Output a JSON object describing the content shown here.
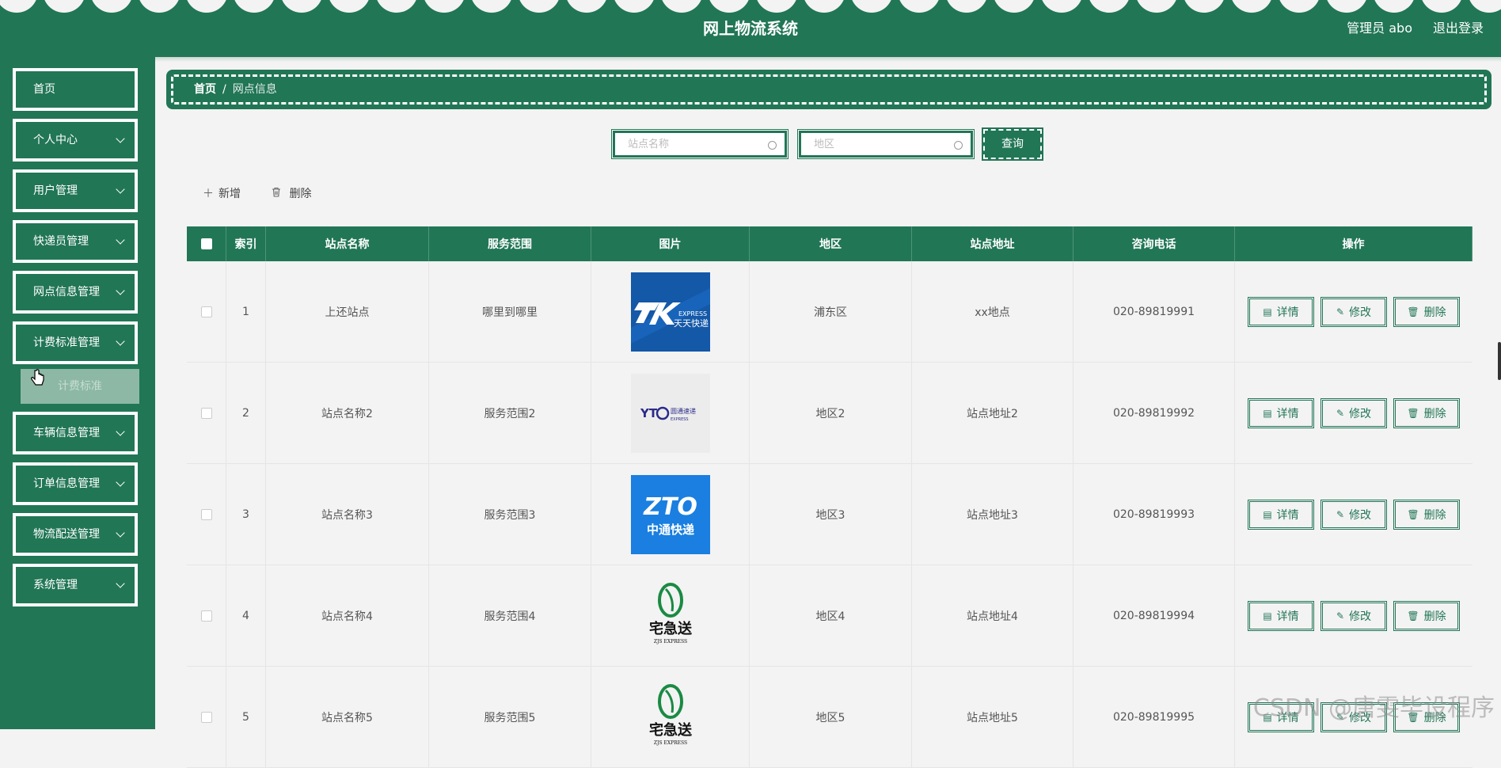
{
  "header": {
    "title": "网上物流系统",
    "admin": "管理员 abo",
    "logout": "退出登录"
  },
  "sidebar": {
    "items": [
      {
        "label": "首页"
      },
      {
        "label": "个人中心"
      },
      {
        "label": "用户管理"
      },
      {
        "label": "快递员管理"
      },
      {
        "label": "网点信息管理"
      },
      {
        "label": "计费标准管理"
      },
      {
        "label": "车辆信息管理"
      },
      {
        "label": "订单信息管理"
      },
      {
        "label": "物流配送管理"
      },
      {
        "label": "系统管理"
      }
    ],
    "submenu": "计费标准"
  },
  "breadcrumb": {
    "home": "首页",
    "sep": "/",
    "current": "网点信息"
  },
  "search": {
    "name_placeholder": "站点名称",
    "area_placeholder": "地区",
    "query_label": "查询"
  },
  "actions": {
    "add": "新增",
    "delete": "删除",
    "add_icon": "plus-icon",
    "delete_icon": "trash-icon"
  },
  "table": {
    "headers": [
      "索引",
      "站点名称",
      "服务范围",
      "图片",
      "地区",
      "站点地址",
      "咨询电话",
      "操作"
    ],
    "op_labels": {
      "detail": "详情",
      "edit": "修改",
      "delete": "删除"
    },
    "rows": [
      {
        "index": "1",
        "name": "上还站点",
        "scope": "哪里到哪里",
        "logo": "tiantian-express-logo",
        "area": "浦东区",
        "address": "xx地点",
        "phone": "020-89819991"
      },
      {
        "index": "2",
        "name": "站点名称2",
        "scope": "服务范围2",
        "logo": "yto-express-logo",
        "area": "地区2",
        "address": "站点地址2",
        "phone": "020-89819992"
      },
      {
        "index": "3",
        "name": "站点名称3",
        "scope": "服务范围3",
        "logo": "zto-express-logo",
        "area": "地区3",
        "address": "站点地址3",
        "phone": "020-89819993"
      },
      {
        "index": "4",
        "name": "站点名称4",
        "scope": "服务范围4",
        "logo": "zjs-express-logo",
        "area": "地区4",
        "address": "站点地址4",
        "phone": "020-89819994"
      },
      {
        "index": "5",
        "name": "站点名称5",
        "scope": "服务范围5",
        "logo": "zjs-express-logo",
        "area": "地区5",
        "address": "站点地址5",
        "phone": "020-89819995"
      }
    ]
  },
  "logo_text": {
    "tt_express": "EXPRESS",
    "tt_cn": "天天快递",
    "yto_mark": "YT",
    "yto_circle": "O",
    "yto_cn": "圆通速递",
    "yto_en": "EXPRESS",
    "zto_en": "ZTO",
    "zto_cn": "中通快递",
    "zjs_cn": "宅急送",
    "zjs_en": "ZJS EXPRESS"
  },
  "watermark": "CSDN @唐雯毕设程序",
  "colors": {
    "primary": "#217656",
    "background": "#f3f3f3",
    "submenu": "#8db8a5"
  }
}
